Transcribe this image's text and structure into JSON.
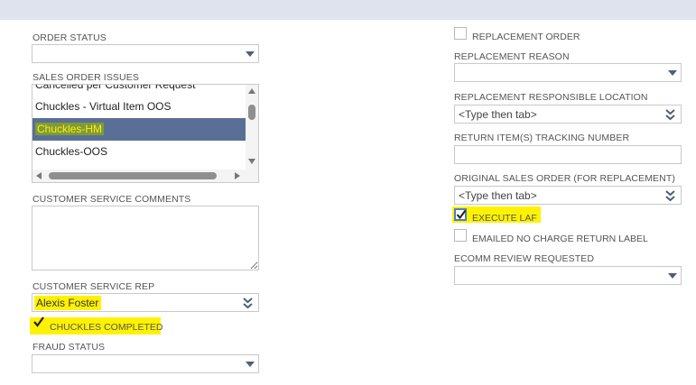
{
  "left": {
    "order_status": {
      "label": "ORDER STATUS",
      "value": ""
    },
    "sales_order_issues": {
      "label": "SALES ORDER ISSUES",
      "items": [
        {
          "label": "Cancelled per Customer Request",
          "selected": false
        },
        {
          "label": "Chuckles - Virtual Item OOS",
          "selected": false
        },
        {
          "label": "Chuckles-HM",
          "selected": true
        },
        {
          "label": "Chuckles-OOS",
          "selected": false
        }
      ]
    },
    "customer_service_comments": {
      "label": "CUSTOMER SERVICE COMMENTS",
      "value": ""
    },
    "customer_service_rep": {
      "label": "CUSTOMER SERVICE REP",
      "value": "Alexis Foster"
    },
    "chuckles_completed": {
      "label": "CHUCKLES COMPLETED",
      "checked": true
    },
    "fraud_status": {
      "label": "FRAUD STATUS",
      "value": ""
    }
  },
  "right": {
    "replacement_order": {
      "label": "REPLACEMENT ORDER",
      "checked": false
    },
    "replacement_reason": {
      "label": "REPLACEMENT REASON",
      "value": ""
    },
    "replacement_responsible_location": {
      "label": "REPLACEMENT RESPONSIBLE LOCATION",
      "placeholder": "<Type then tab>"
    },
    "return_tracking_number": {
      "label": "RETURN ITEM(S) TRACKING NUMBER",
      "value": ""
    },
    "original_sales_order": {
      "label": "ORIGINAL SALES ORDER (FOR REPLACEMENT)",
      "placeholder": "<Type then tab>"
    },
    "execute_laf": {
      "label": "EXECUTE LAF",
      "checked": true
    },
    "emailed_no_charge_return_label": {
      "label": "EMAILED NO CHARGE RETURN LABEL",
      "checked": false
    },
    "ecomm_review_requested": {
      "label": "ECOMM REVIEW REQUESTED",
      "value": ""
    }
  },
  "colors": {
    "highlight": "#fff200",
    "selected_row": "#5a6f96",
    "dropdown_arrow": "#4d5f7a"
  }
}
